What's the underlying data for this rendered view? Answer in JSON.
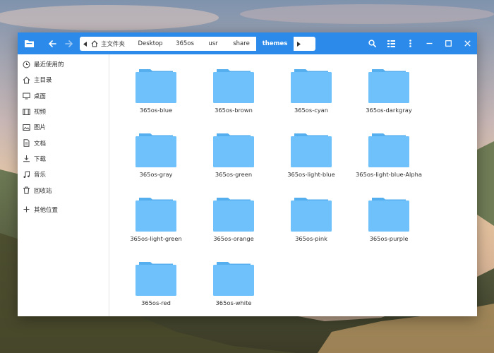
{
  "window": {
    "sidebar": {
      "items": [
        {
          "label": "最近使用的",
          "icon": "clock-icon"
        },
        {
          "label": "主目录",
          "icon": "home-icon"
        },
        {
          "label": "桌面",
          "icon": "desktop-icon"
        },
        {
          "label": "视频",
          "icon": "video-icon"
        },
        {
          "label": "图片",
          "icon": "picture-icon"
        },
        {
          "label": "文档",
          "icon": "document-icon"
        },
        {
          "label": "下载",
          "icon": "download-icon"
        },
        {
          "label": "音乐",
          "icon": "music-icon"
        },
        {
          "label": "回收站",
          "icon": "trash-icon"
        }
      ],
      "other_locations": {
        "label": "其他位置",
        "icon": "plus-icon"
      }
    },
    "breadcrumb": {
      "home": "主文件夹",
      "items": [
        "Desktop",
        "365os",
        "usr",
        "share",
        "themes"
      ],
      "active": "themes"
    },
    "folders": [
      "365os-blue",
      "365os-brown",
      "365os-cyan",
      "365os-darkgray",
      "365os-gray",
      "365os-green",
      "365os-light-blue",
      "365os-light-blue-Alpha",
      "365os-light-green",
      "365os-orange",
      "365os-pink",
      "365os-purple",
      "365os-red",
      "365os-white"
    ]
  },
  "colors": {
    "titlebar": "#2c8bea",
    "folder_body": "#6fc1fb",
    "folder_tab": "#55afef",
    "text": "#303030"
  }
}
